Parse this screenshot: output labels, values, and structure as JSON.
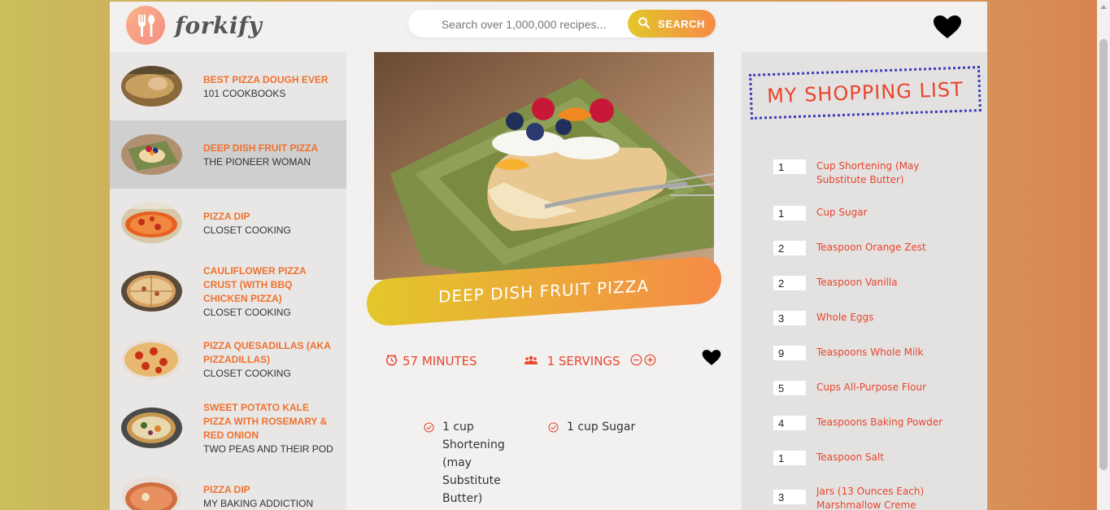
{
  "header": {
    "logo_text": "forkify",
    "search_placeholder": "Search over 1,000,000 recipes...",
    "search_button": "SEARCH"
  },
  "results": [
    {
      "title": "BEST PIZZA DOUGH EVER",
      "author": "101 COOKBOOKS",
      "active": false
    },
    {
      "title": "DEEP DISH FRUIT PIZZA",
      "author": "THE PIONEER WOMAN",
      "active": true
    },
    {
      "title": "PIZZA DIP",
      "author": "CLOSET COOKING",
      "active": false
    },
    {
      "title": "CAULIFLOWER PIZZA CRUST (WITH BBQ CHICKEN PIZZA)",
      "author": "CLOSET COOKING",
      "active": false
    },
    {
      "title": "PIZZA QUESADILLAS (AKA PIZZADILLAS)",
      "author": "CLOSET COOKING",
      "active": false
    },
    {
      "title": "SWEET POTATO KALE PIZZA WITH ROSEMARY & RED ONION",
      "author": "TWO PEAS AND THEIR POD",
      "active": false
    },
    {
      "title": "PIZZA DIP",
      "author": "MY BAKING ADDICTION",
      "active": false
    }
  ],
  "recipe": {
    "title": "DEEP DISH FRUIT PIZZA",
    "time": "57 MINUTES",
    "servings": "1 SERVINGS",
    "ingredients": [
      {
        "text": "1 cup Shortening (may Substitute Butter)"
      },
      {
        "text": "1 cup Sugar"
      }
    ]
  },
  "shopping": {
    "title": "MY SHOPPING LIST",
    "items": [
      {
        "count": "1",
        "text": "Cup Shortening (May Substitute Butter)"
      },
      {
        "count": "1",
        "text": "Cup Sugar"
      },
      {
        "count": "2",
        "text": "Teaspoon Orange Zest"
      },
      {
        "count": "2",
        "text": "Teaspoon Vanilla"
      },
      {
        "count": "3",
        "text": "Whole Eggs"
      },
      {
        "count": "9",
        "text": "Teaspoons Whole Milk"
      },
      {
        "count": "5",
        "text": "Cups All-Purpose Flour"
      },
      {
        "count": "4",
        "text": "Teaspoons Baking Powder"
      },
      {
        "count": "1",
        "text": "Teaspoon Salt"
      },
      {
        "count": "3",
        "text": "Jars (13 Ounces Each) Marshmallow Creme"
      }
    ]
  },
  "colors": {
    "accent": "#e8452d",
    "result_title": "#f0712f",
    "gradient_start": "#e3c72a",
    "gradient_end": "#f58b47",
    "stamp_border": "#3e3cb9"
  },
  "icons": [
    "fork-spoon-icon",
    "search-icon",
    "heart-icon",
    "clock-icon",
    "people-icon",
    "minus-circle-icon",
    "plus-circle-icon",
    "check-circle-icon"
  ]
}
